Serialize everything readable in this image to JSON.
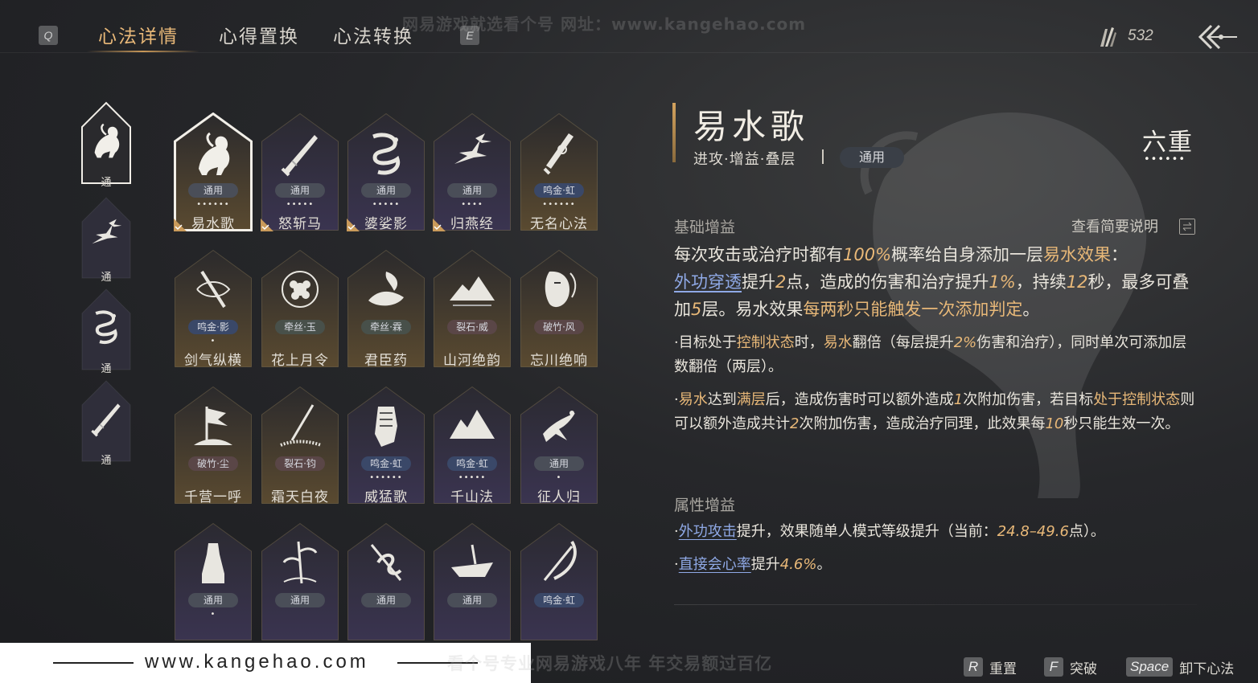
{
  "header": {
    "tabs": [
      {
        "label": "心法详情",
        "active": true
      },
      {
        "label": "心得置换",
        "active": false
      },
      {
        "label": "心法转换",
        "active": false
      }
    ],
    "left_key": "Q",
    "right_key": "E",
    "currency_icon": "quill-currency-icon",
    "currency_value": "532",
    "back_icon": "back-arrow-icon"
  },
  "watermark": {
    "top": "网易游戏就选看个号   网址：www.kangehao.com",
    "bottom_url": "www.kangehao.com",
    "bottom_slogan": "看个号专业网易游戏八年   年交易额过百亿"
  },
  "side_categories": [
    {
      "label": "通",
      "icon": "horse-icon",
      "selected": true
    },
    {
      "label": "通",
      "icon": "swallows-icon",
      "selected": false
    },
    {
      "label": "通",
      "icon": "dragon-icon",
      "selected": false
    },
    {
      "label": "通",
      "icon": "blade-icon",
      "selected": false
    }
  ],
  "grid": [
    {
      "name": "易水歌",
      "tag": "通用",
      "tag_style": "plain",
      "dots": "••••••",
      "icon": "horse-icon",
      "selected": true,
      "equipped": true,
      "bg": "gold"
    },
    {
      "name": "怒斩马",
      "tag": "通用",
      "tag_style": "plain",
      "dots": "•••••",
      "icon": "blade-icon",
      "selected": false,
      "equipped": true,
      "bg": "purple"
    },
    {
      "name": "婆娑影",
      "tag": "通用",
      "tag_style": "plain",
      "dots": "•••••",
      "icon": "dragon-icon",
      "selected": false,
      "equipped": true,
      "bg": "purple"
    },
    {
      "name": "归燕经",
      "tag": "通用",
      "tag_style": "plain",
      "dots": "••••",
      "icon": "swallows-icon",
      "selected": false,
      "equipped": true,
      "bg": "purple"
    },
    {
      "name": "无名心法",
      "tag": "鸣金·虹",
      "tag_style": "gold",
      "dots": "••••••",
      "icon": "sword-icon",
      "selected": false,
      "equipped": false,
      "bg": "gold"
    },
    {
      "name": "剑气纵横",
      "tag": "鸣金·影",
      "tag_style": "gold",
      "dots": "•",
      "icon": "sword-swirl-icon",
      "selected": false,
      "equipped": false,
      "bg": "gold"
    },
    {
      "name": "花上月令",
      "tag": "牵丝·玉",
      "tag_style": "jade",
      "dots": "",
      "icon": "flower-moon-icon",
      "selected": false,
      "equipped": false,
      "bg": "gold"
    },
    {
      "name": "君臣药",
      "tag": "牵丝·霖",
      "tag_style": "jade",
      "dots": "",
      "icon": "herb-icon",
      "selected": false,
      "equipped": false,
      "bg": "gold"
    },
    {
      "name": "山河绝韵",
      "tag": "裂石·威",
      "tag_style": "red",
      "dots": "",
      "icon": "mountain-icon",
      "selected": false,
      "equipped": false,
      "bg": "gold"
    },
    {
      "name": "忘川绝响",
      "tag": "破竹·风",
      "tag_style": "red",
      "dots": "",
      "icon": "mask-icon",
      "selected": false,
      "equipped": false,
      "bg": "gold"
    },
    {
      "name": "千营一呼",
      "tag": "破竹·尘",
      "tag_style": "red",
      "dots": "",
      "icon": "flag-icon",
      "selected": false,
      "equipped": false,
      "bg": "gold"
    },
    {
      "name": "霜天白夜",
      "tag": "裂石·钧",
      "tag_style": "red",
      "dots": "",
      "icon": "spear-icon",
      "selected": false,
      "equipped": false,
      "bg": "gold"
    },
    {
      "name": "威猛歌",
      "tag": "鸣金·虹",
      "tag_style": "gold",
      "dots": "••••••",
      "icon": "fist-icon",
      "selected": false,
      "equipped": false,
      "bg": "purple"
    },
    {
      "name": "千山法",
      "tag": "鸣金·虹",
      "tag_style": "gold",
      "dots": "•••••",
      "icon": "peaks-icon",
      "selected": false,
      "equipped": false,
      "bg": "purple"
    },
    {
      "name": "征人归",
      "tag": "通用",
      "tag_style": "plain",
      "dots": "•",
      "icon": "falcon-icon",
      "selected": false,
      "equipped": false,
      "bg": "purple"
    },
    {
      "name": "",
      "tag": "通用",
      "tag_style": "plain",
      "dots": "•",
      "icon": "statue-icon",
      "selected": false,
      "equipped": false,
      "bg": "purple"
    },
    {
      "name": "",
      "tag": "通用",
      "tag_style": "plain",
      "dots": "",
      "icon": "bamboo-icon",
      "selected": false,
      "equipped": false,
      "bg": "purple"
    },
    {
      "name": "",
      "tag": "通用",
      "tag_style": "plain",
      "dots": "",
      "icon": "serpent-sword-icon",
      "selected": false,
      "equipped": false,
      "bg": "purple"
    },
    {
      "name": "",
      "tag": "通用",
      "tag_style": "plain",
      "dots": "",
      "icon": "boat-icon",
      "selected": false,
      "equipped": false,
      "bg": "purple"
    },
    {
      "name": "",
      "tag": "鸣金·虹",
      "tag_style": "gold",
      "dots": "",
      "icon": "scythe-icon",
      "selected": false,
      "equipped": false,
      "bg": "purple"
    }
  ],
  "detail": {
    "title": "易水歌",
    "subtitle": "进攻·增益·叠层",
    "type_badge": "通用",
    "rank": "六重",
    "rank_dots": "••••••",
    "basic_heading": "基础增益",
    "brief_link": "查看简要说明",
    "basic_desc": {
      "p1": "每次攻击或治疗时都有",
      "v1": "100%",
      "p2": "概率给自身添加一层",
      "k1": "易水效果",
      "p3": "：",
      "l1": "外功穿透",
      "p4": "提升",
      "v2": "2",
      "p5": "点，造成的伤害和治疗提升",
      "v3": "1%",
      "p6": "，持续",
      "v4": "12",
      "p7": "秒，最多可叠加",
      "v5": "5",
      "p8": "层。易水效果",
      "k2": "每两秒只能触发一次添加判定",
      "p9": "。"
    },
    "bullet1": {
      "p1": "·目标处于",
      "k1": "控制状态",
      "p2": "时，",
      "k2": "易水",
      "p3": "翻倍（每层提升",
      "v1": "2%",
      "p4": "伤害和治疗），同时单次可添加层数翻倍（两层）。"
    },
    "bullet2": {
      "p1": "·",
      "k1": "易水",
      "p2": "达到",
      "k2": "满层",
      "p3": "后，造成伤害时可以额外造成",
      "v1": "1",
      "p4": "次附加伤害，若目标",
      "k3": "处于控制状态",
      "p5": "则可以额外造成共计",
      "v2": "2",
      "p6": "次附加伤害，造成治疗同理，此效果每",
      "v3": "10",
      "p7": "秒只能生效一次。"
    },
    "attr_heading": "属性增益",
    "attr1": {
      "p1": "·",
      "l1": "外功攻击",
      "p2": "提升，效果随单人模式等级提升（当前：",
      "v1": "24.8–49.6",
      "p3": "点）。"
    },
    "attr2": {
      "p1": "·",
      "l1": "直接会心率",
      "p2": "提升",
      "v1": "4.6%",
      "p3": "。"
    }
  },
  "actions": [
    {
      "key": "R",
      "label": "重置"
    },
    {
      "key": "F",
      "label": "突破"
    },
    {
      "key": "Space",
      "label": "卸下心法"
    }
  ]
}
